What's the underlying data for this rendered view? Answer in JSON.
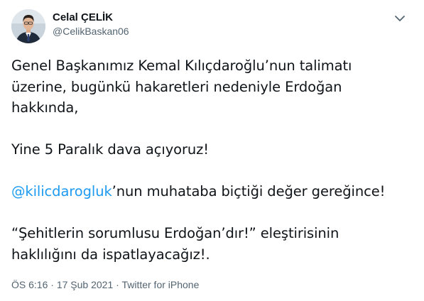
{
  "author": {
    "display_name": "Celal ÇELİK",
    "handle": "@CelikBaskan06",
    "avatar_icon": "person-photo-avatar"
  },
  "more_icon": "chevron-down-icon",
  "tweet": {
    "p1_lines": [
      "Genel Başkanımız Kemal Kılıçdaroğlu’nun talimatı",
      "üzerine, bugünkü hakaretleri nedeniyle Erdoğan",
      "hakkında,"
    ],
    "p2": "Yine 5 Paralık dava açıyoruz!",
    "p3_mention": "@kilicdarogluk",
    "p3_rest": "’nun muhataba biçtiği değer gereğince!",
    "p4_lines": [
      "“Şehitlerin sorumlusu Erdoğan’dır!” eleştirisinin",
      "haklılığını da ispatlayacağız!."
    ]
  },
  "meta": {
    "time": "ÖS 6:16",
    "separator": " · ",
    "date": "17 Şub 2021",
    "source": "Twitter for iPhone"
  },
  "colors": {
    "text": "#0f1419",
    "secondary": "#536471",
    "link": "#1d9bf0"
  }
}
